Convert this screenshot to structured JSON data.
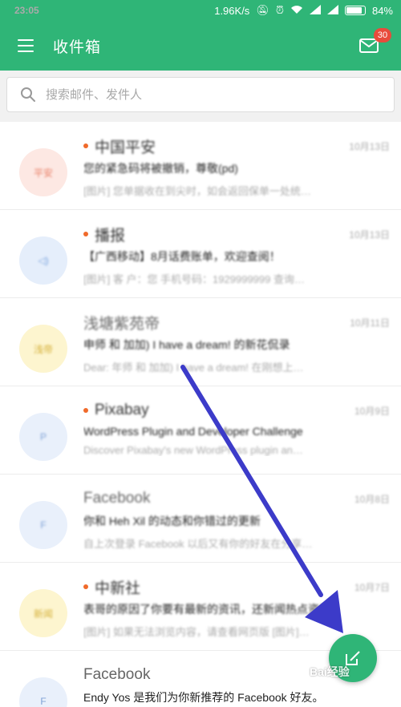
{
  "status_bar": {
    "time": "23:05",
    "network_speed": "1.96K/s",
    "battery": "84%"
  },
  "app_bar": {
    "title": "收件箱",
    "badge_count": "30",
    "accent": "#2fb577"
  },
  "search": {
    "placeholder": "搜索邮件、发件人"
  },
  "mails": [
    {
      "sender": "中国平安",
      "unread": true,
      "time": "10月13日",
      "subject": "您的紧急码将被撤销，尊敬(pd)",
      "preview": "[图片] 您单据收在到尖时，如会返回保单一处统…",
      "avatar_text": "平安",
      "avatar_bg": "#fde8e3",
      "avatar_fg": "#e9826a"
    },
    {
      "sender": "播报",
      "unread": true,
      "time": "10月13日",
      "subject": "【广西移动】8月话费账单，欢迎查阅！",
      "preview": "[图片] 客 户：您 手机号码：1929999999 查询…",
      "avatar_text": "◁)",
      "avatar_bg": "#e5eefb",
      "avatar_fg": "#7aa3de"
    },
    {
      "sender": "浅塘紫苑帝",
      "unread": false,
      "time": "10月11日",
      "subject": "申师 和 加加) I have a dream! 的新花侃录",
      "preview": "Dear: 年师 和 加加) I have a dream! 在刚想上…",
      "avatar_text": "浅帝",
      "avatar_bg": "#fdf5cf",
      "avatar_fg": "#d6b23d"
    },
    {
      "sender": "Pixabay",
      "unread": true,
      "time": "10月9日",
      "subject": "WordPress Plugin and Developer Challenge",
      "preview": "Discover Pixabay's new WordPress plugin an…",
      "avatar_text": "P",
      "avatar_bg": "#e9f0fb",
      "avatar_fg": "#7ea1d6"
    },
    {
      "sender": "Facebook",
      "unread": false,
      "time": "10月8日",
      "subject": "你和 Heh Xil 的动态和你错过的更新",
      "preview": "自上次登录 Facebook 以后又有你的好友在分享…",
      "avatar_text": "F",
      "avatar_bg": "#e9f0fb",
      "avatar_fg": "#7ea1d6"
    },
    {
      "sender": "中新社",
      "unread": true,
      "time": "10月7日",
      "subject": "表哥的原因了你要有最新的资讯，还新闻热点资讯",
      "preview": "[图片] 如果无法浏览内容，请查看网页版 [图片]…",
      "avatar_text": "新闻",
      "avatar_bg": "#fdf5cf",
      "avatar_fg": "#d6b23d"
    },
    {
      "sender": "Facebook",
      "unread": false,
      "time": "",
      "subject": "Endy Yos 是我们为你新推荐的 Facebook 好友。",
      "preview": "",
      "avatar_text": "F",
      "avatar_bg": "#e9f0fb",
      "avatar_fg": "#7ea1d6"
    }
  ],
  "fab": {
    "icon": "compose-icon"
  },
  "watermark": "Bai经验",
  "annotation": {
    "arrow_color": "#3c3bc9"
  }
}
